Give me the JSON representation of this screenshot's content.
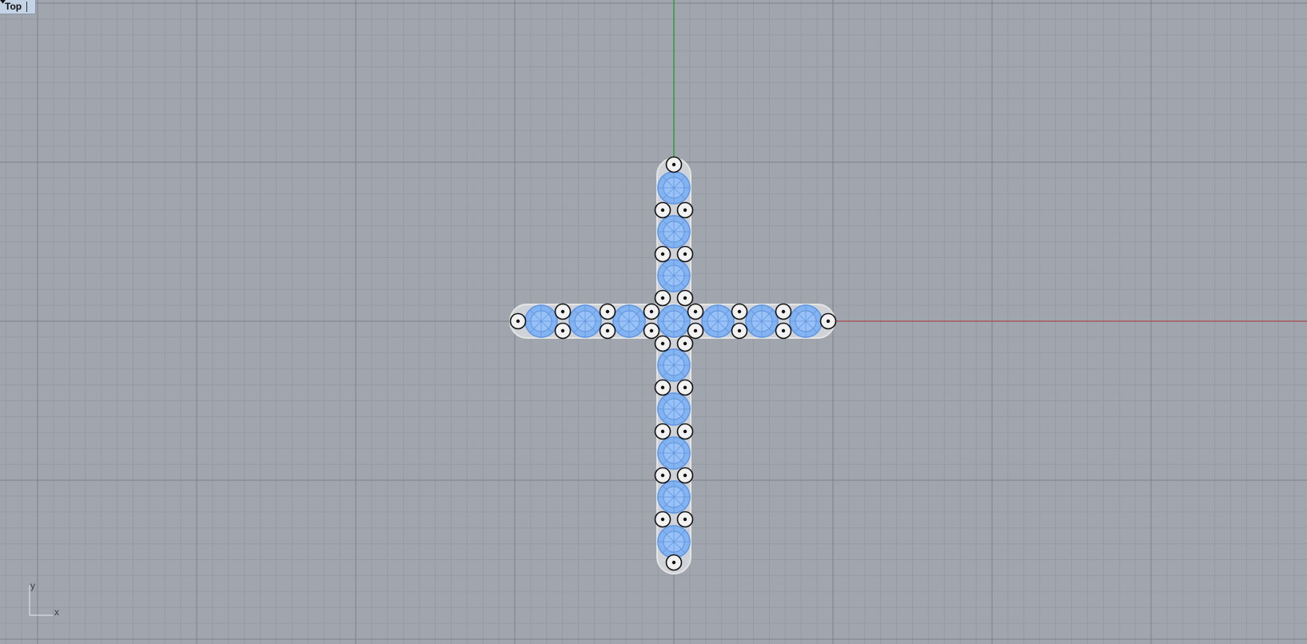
{
  "viewport": {
    "name": "Top",
    "menu_icon": "triangle-down-icon",
    "background_color": "#a1a6ae",
    "x_axis_color": "#a45a5e",
    "y_axis_color": "#2f9a3c"
  },
  "axis_icon": {
    "x_label": "x",
    "y_label": "y"
  },
  "object": {
    "shape": "cross",
    "highlight_color": "#7fb1f3",
    "edge_color": "#e4e4e4",
    "vertical_arm_gems": 9,
    "horizontal_arm_gems": 7
  }
}
